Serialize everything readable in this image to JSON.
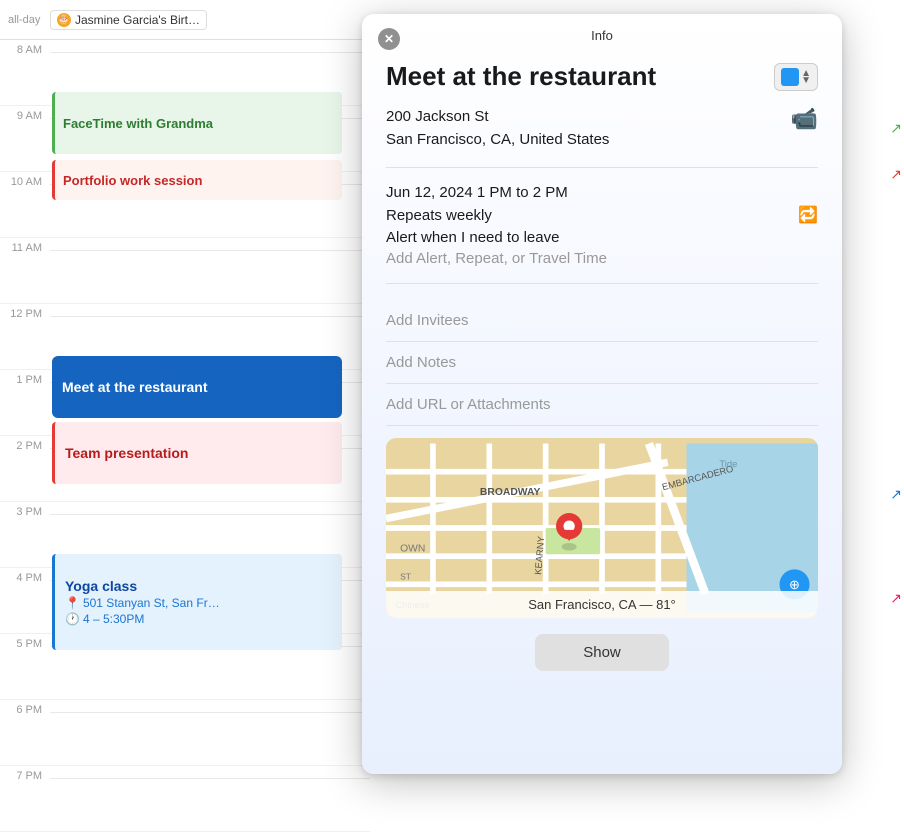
{
  "calendar": {
    "allday_label": "all-day",
    "allday_event": "Jasmine Garcia's Birt…",
    "time_slots": [
      {
        "time": "8 AM"
      },
      {
        "time": "9 AM"
      },
      {
        "time": "10 AM"
      },
      {
        "time": "11 AM"
      },
      {
        "time": "12 PM"
      },
      {
        "time": "1 PM"
      },
      {
        "time": "2 PM"
      },
      {
        "time": "3 PM"
      },
      {
        "time": "4 PM"
      },
      {
        "time": "5 PM"
      },
      {
        "time": "6 PM"
      },
      {
        "time": "7 PM"
      }
    ],
    "events": {
      "facetime": "FaceTime with Grandma",
      "portfolio": "Portfolio work session",
      "restaurant": "Meet at the restaurant",
      "team": "Team presentation",
      "yoga_title": "Yoga class",
      "yoga_address": "501 Stanyan St, San Fr…",
      "yoga_time": "4 – 5:30PM"
    }
  },
  "popup": {
    "header_title": "Info",
    "close_icon": "✕",
    "event_title": "Meet at the restaurant",
    "calendar_color": "#2196f3",
    "location_line1": "200 Jackson St",
    "location_line2": "San Francisco, CA, United States",
    "datetime": "Jun 12, 2024  1 PM to 2 PM",
    "repeats": "Repeats weekly",
    "alert": "Alert when I need to leave",
    "add_alert": "Add Alert, Repeat, or Travel Time",
    "add_invitees": "Add Invitees",
    "add_notes": "Add Notes",
    "add_url": "Add URL or Attachments",
    "map_label": "San Francisco, CA — 81°",
    "show_button": "Show"
  }
}
